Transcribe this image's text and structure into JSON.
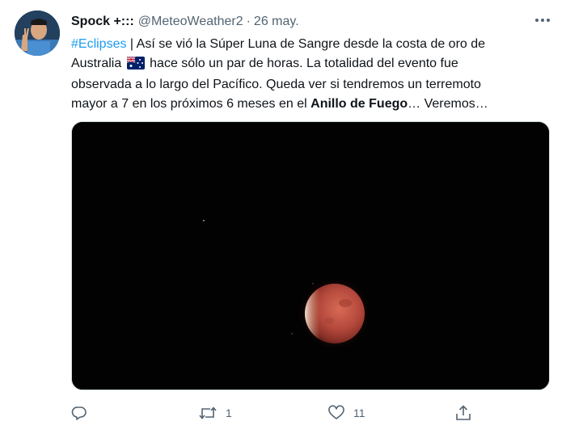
{
  "tweet": {
    "author": {
      "name": "Spock +:::",
      "handle": "@MeteoWeather2",
      "separator": "·",
      "date": "26 may."
    },
    "more_icon": "ellipsis-icon",
    "text": {
      "hashtag": "#Eclipses",
      "line1_rest": " | Así se vió la Súper Luna de Sangre desde la costa de oro de",
      "line2_start": "Australia",
      "flag_emoji": "australia-flag-icon",
      "line2_rest": " hace sólo un par de horas. La totalidad del evento fue",
      "line3": "observada a lo largo del Pacífico. Queda ver si tendremos un terremoto",
      "line4_start": "mayor a 7 en los próximos 6 meses en el ",
      "bold_phrase": "Anillo de Fuego",
      "line4_end": "… Veremos…"
    },
    "actions": {
      "reply": {
        "icon": "reply-icon",
        "count": ""
      },
      "retweet": {
        "icon": "retweet-icon",
        "count": "1"
      },
      "like": {
        "icon": "heart-icon",
        "count": "11"
      },
      "share": {
        "icon": "share-icon",
        "count": ""
      }
    },
    "colors": {
      "link": "#1d9bf0",
      "secondary": "#536471",
      "moon": "#c0584a"
    }
  }
}
